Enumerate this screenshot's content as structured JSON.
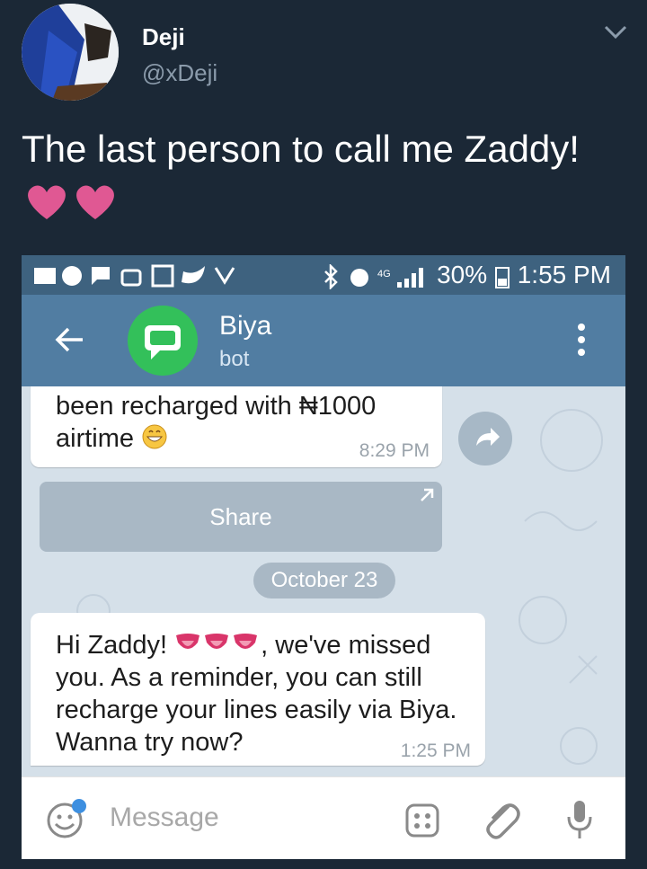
{
  "tweet": {
    "display_name": "Deji",
    "handle": "@xDeji",
    "text": "The last person to call me Zaddy!",
    "emoji": "pink-hearts-x2"
  },
  "phone": {
    "status": {
      "battery": "30%",
      "time": "1:55 PM",
      "network": "4G"
    },
    "chat_header": {
      "name": "Biya",
      "subtitle": "bot"
    },
    "messages": [
      {
        "text_line1": "been recharged with ₦1000",
        "text_line2": "airtime",
        "time": "8:29 PM"
      },
      {
        "text_pre": "Hi Zaddy!",
        "text_post": ", we've missed",
        "text_rest1": "you. As a reminder, you can still",
        "text_rest2": "recharge your lines easily via Biya.",
        "text_rest3": "Wanna try now?",
        "time": "1:25 PM"
      }
    ],
    "share_label": "Share",
    "date_separator": "October 23",
    "input_placeholder": "Message"
  },
  "colors": {
    "page_bg": "#1b2836",
    "status_bar": "#3e627f",
    "app_bar": "#517da2",
    "bot_avatar": "#33c05a",
    "heart": "#e05893"
  }
}
